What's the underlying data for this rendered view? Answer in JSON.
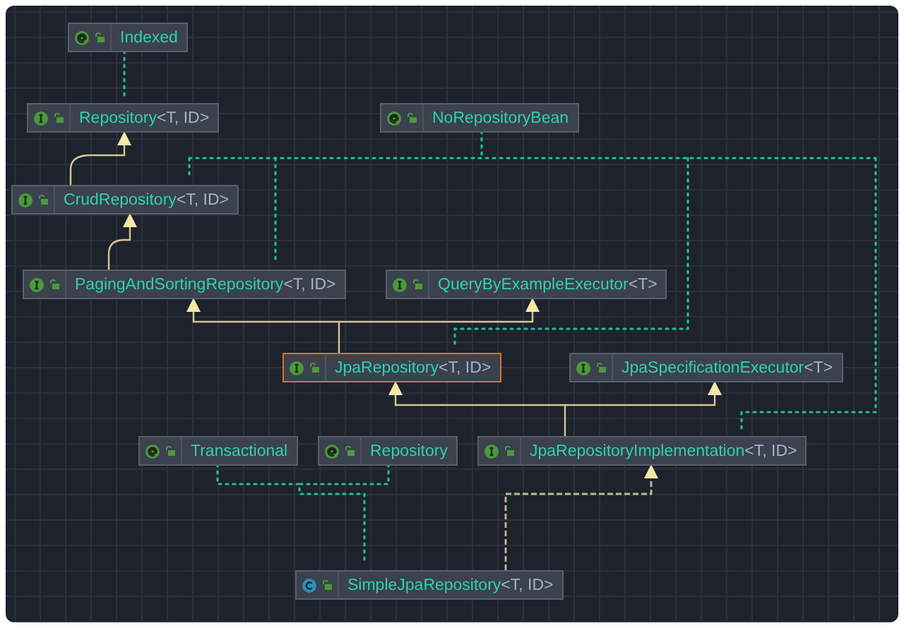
{
  "diagram": {
    "nodes": [
      {
        "kind": "annotation",
        "name": "Indexed",
        "selected": false
      },
      {
        "kind": "interface",
        "name": "Repository",
        "generics": "<T, ID>",
        "selected": false
      },
      {
        "kind": "annotation",
        "name": "NoRepositoryBean",
        "selected": false
      },
      {
        "kind": "interface",
        "name": "CrudRepository",
        "generics": "<T, ID>",
        "selected": false
      },
      {
        "kind": "interface",
        "name": "PagingAndSortingRepository",
        "generics": "<T, ID>",
        "selected": false
      },
      {
        "kind": "interface",
        "name": "QueryByExampleExecutor",
        "generics": "<T>",
        "selected": false
      },
      {
        "kind": "interface",
        "name": "JpaRepository",
        "generics": "<T, ID>",
        "selected": true
      },
      {
        "kind": "interface",
        "name": "JpaSpecificationExecutor",
        "generics": "<T>",
        "selected": false
      },
      {
        "kind": "annotation",
        "name": "Transactional",
        "selected": false
      },
      {
        "kind": "annotation",
        "name": "Repository",
        "selected": false
      },
      {
        "kind": "interface",
        "name": "JpaRepositoryImplementation",
        "generics": "<T, ID>",
        "selected": false
      },
      {
        "kind": "class",
        "name": "SimpleJpaRepository",
        "generics": "<T, ID>",
        "selected": false
      }
    ]
  }
}
